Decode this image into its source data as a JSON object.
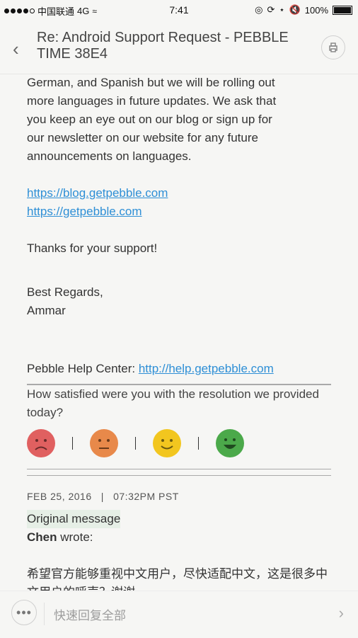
{
  "status": {
    "carrier": "中国联通",
    "network": "4G",
    "time": "7:41",
    "battery": "100%"
  },
  "header": {
    "title": "Re: Android Support Request - PEBBLE TIME 38E4",
    "back_icon": "chevron-left-icon",
    "action_icon": "print-icon"
  },
  "email": {
    "paragraph_lines": [
      "German, and Spanish but we will be rolling out",
      "more languages in future updates. We ask that",
      "you keep an eye out on our blog or sign up for",
      "our newsletter on our website for any future",
      "announcements on languages."
    ],
    "link_blog": "https://blog.getpebble.com",
    "link_site": "https://getpebble.com",
    "thanks": "Thanks for your support!",
    "regards": "Best Regards,",
    "signature": "Ammar",
    "help_label": "Pebble Help Center:",
    "help_link": "http://help.getpebble.com",
    "satisfaction_question": "How satisfied were you with the resolution we provided today?",
    "faces": [
      {
        "name": "very-unhappy",
        "color": "#e06060"
      },
      {
        "name": "unhappy",
        "color": "#e8894a"
      },
      {
        "name": "happy",
        "color": "#f2c61f"
      },
      {
        "name": "very-happy",
        "color": "#4ba94a"
      }
    ],
    "date": "FEB 25, 2016",
    "time": "07:32PM PST",
    "original_label": "Original message",
    "sender": "Chen",
    "wrote": "wrote:",
    "chinese_body": "希望官方能够重视中文用户，尽快适配中文，这是很多中文用户的呼声？谢谢"
  },
  "bottom": {
    "reply_placeholder": "快速回复全部"
  }
}
